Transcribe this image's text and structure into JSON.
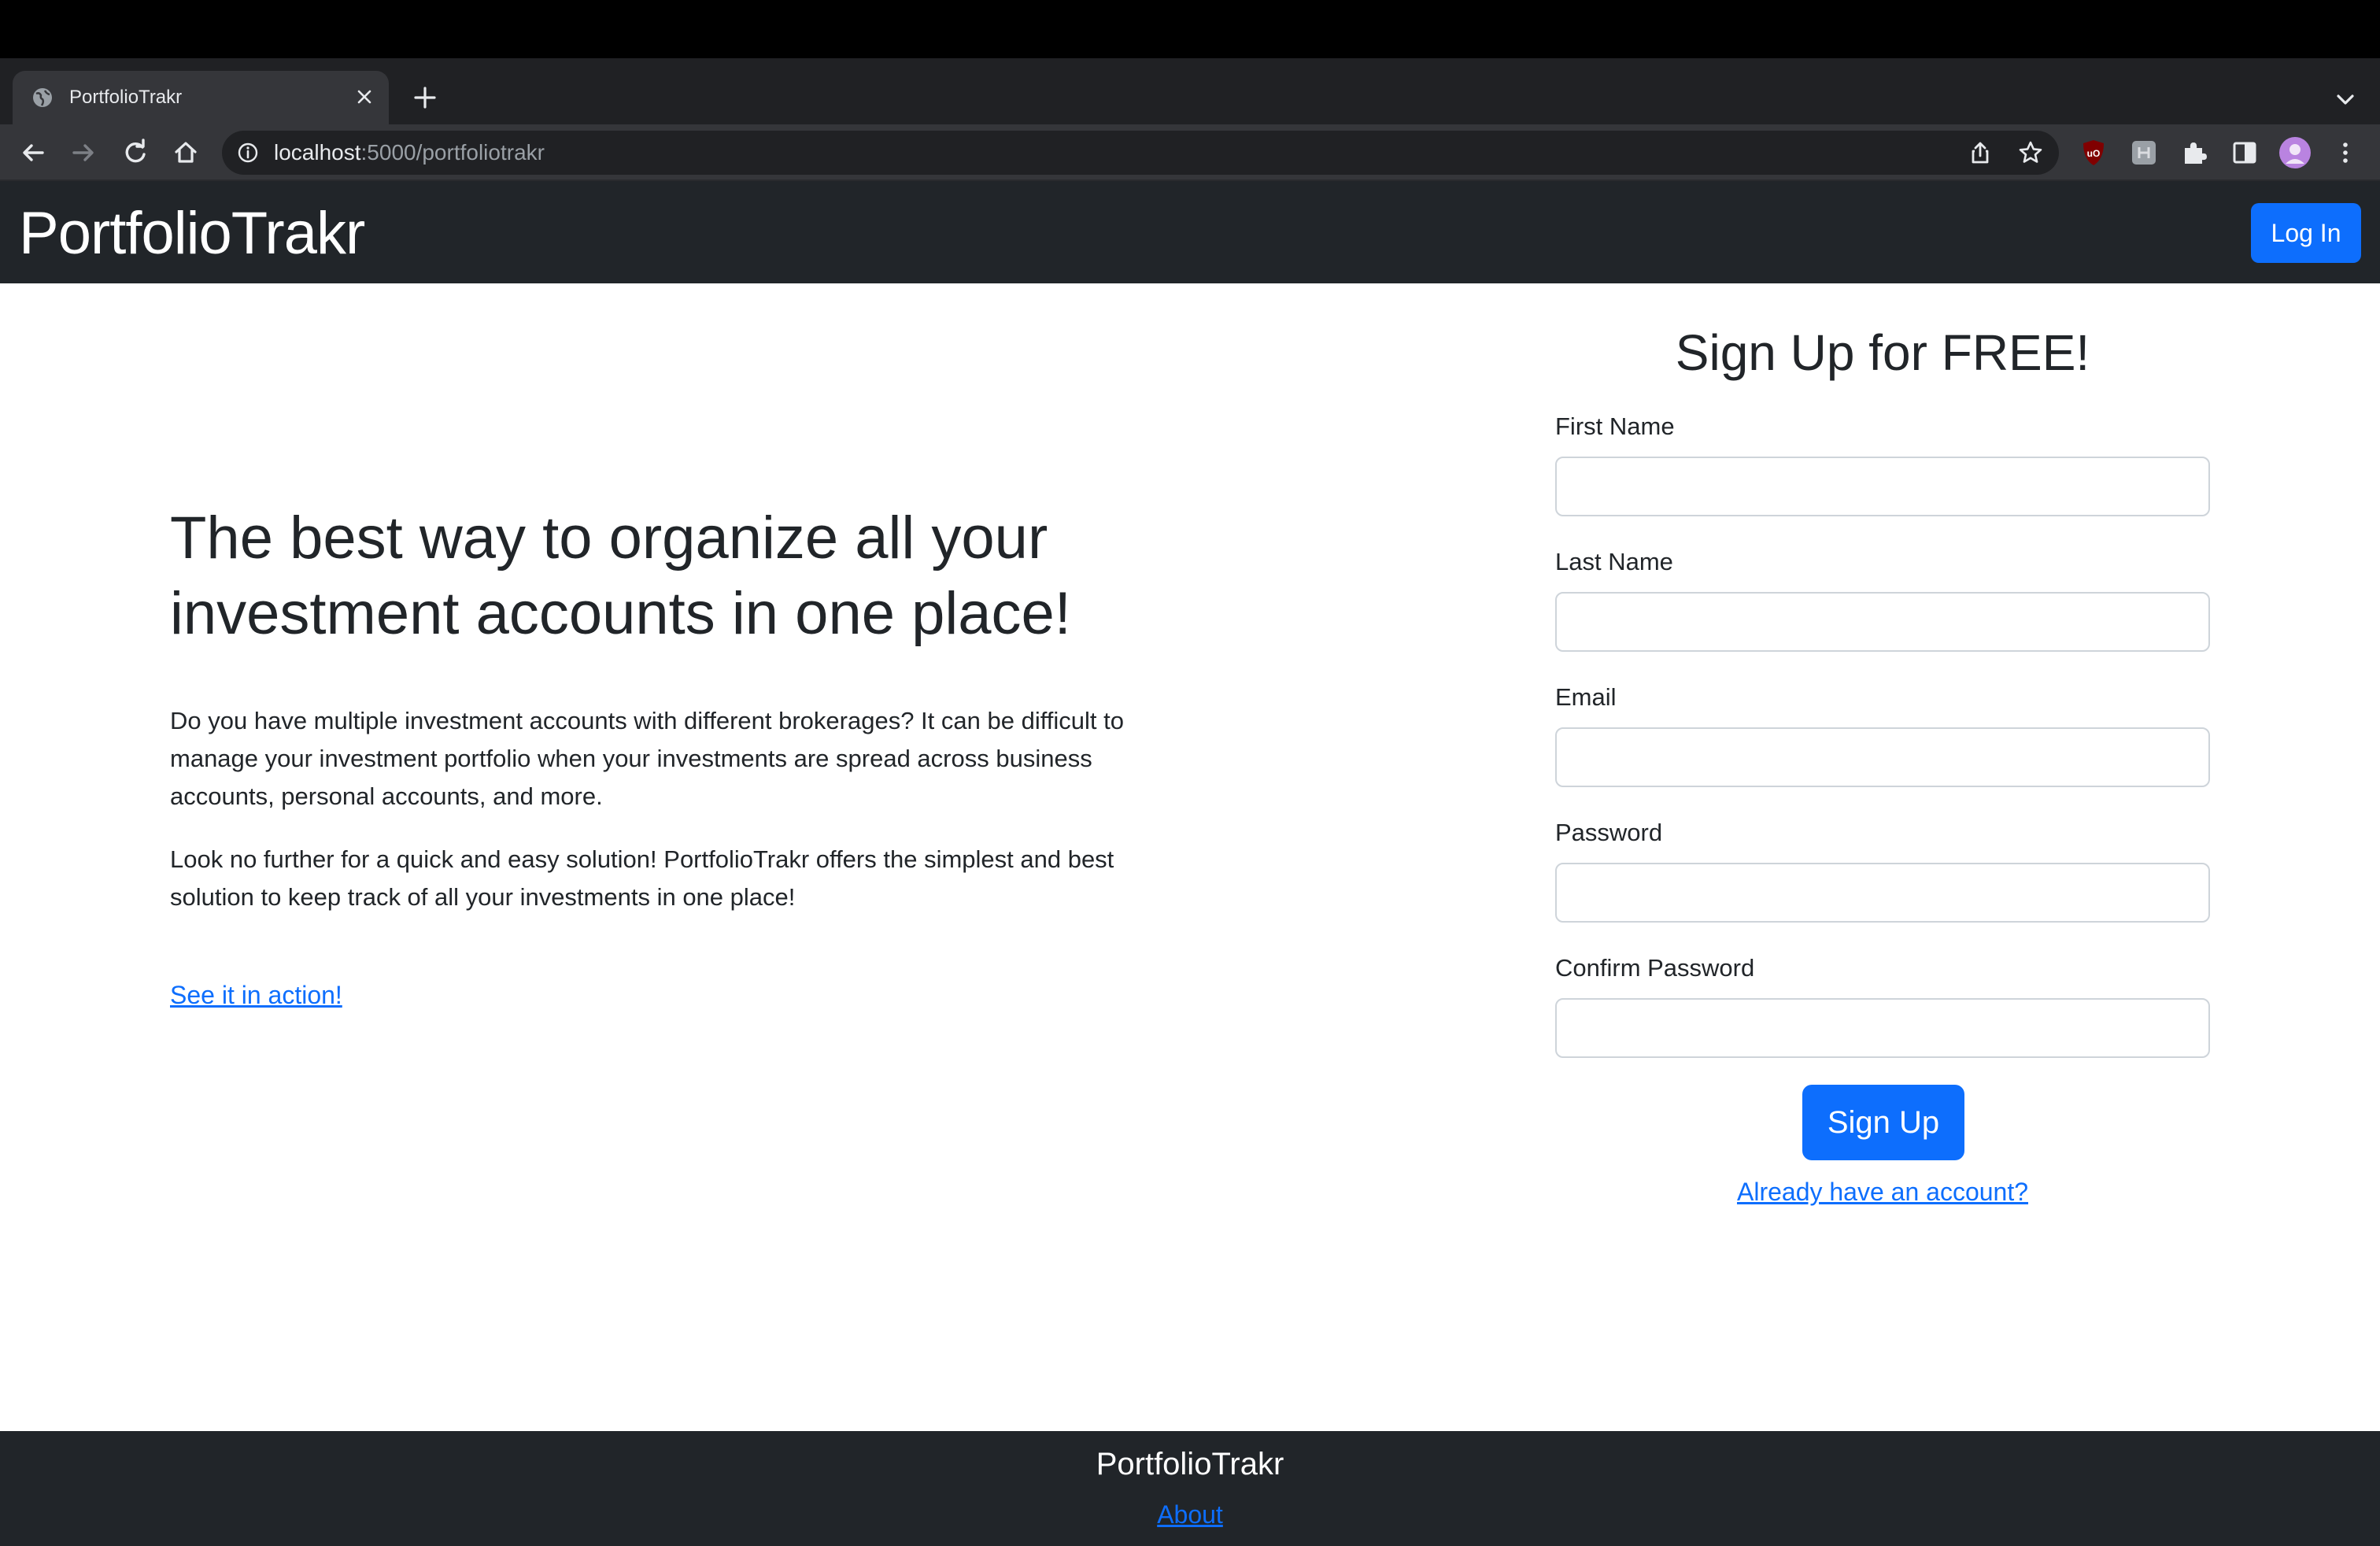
{
  "browser": {
    "tab": {
      "title": "PortfolioTrakr",
      "favicon": "globe-icon"
    },
    "url": {
      "host": "localhost",
      "rest": ":5000/portfoliotrakr"
    },
    "icons": {
      "back": "arrow-left-icon",
      "forward": "arrow-right-icon",
      "reload": "reload-icon",
      "home": "home-icon",
      "share": "share-icon",
      "bookmark": "star-icon",
      "extensions": "puzzle-icon",
      "sidepanel": "sidepanel-icon",
      "menu": "kebab-menu-icon"
    }
  },
  "navbar": {
    "brand": "PortfolioTrakr",
    "login_label": "Log In"
  },
  "hero": {
    "title": "The best way to organize all your investment accounts in one place!",
    "paragraph1": "Do you have multiple investment accounts with different brokerages? It can be difficult to manage your investment portfolio when your investments are spread across business accounts, personal accounts, and more.",
    "paragraph2": "Look no further for a quick and easy solution! PortfolioTrakr offers the simplest and best solution to keep track of all your investments in one place!",
    "action_link": "See it in action!"
  },
  "signup": {
    "title": "Sign Up for FREE!",
    "fields": [
      {
        "label": "First Name",
        "value": ""
      },
      {
        "label": "Last Name",
        "value": ""
      },
      {
        "label": "Email",
        "value": ""
      },
      {
        "label": "Password",
        "value": ""
      },
      {
        "label": "Confirm Password",
        "value": ""
      }
    ],
    "submit_label": "Sign Up",
    "account_link": "Already have an account?"
  },
  "footer": {
    "brand": "PortfolioTrakr",
    "about_link": "About"
  },
  "colors": {
    "primary": "#0d6efd",
    "dark": "#212529"
  }
}
